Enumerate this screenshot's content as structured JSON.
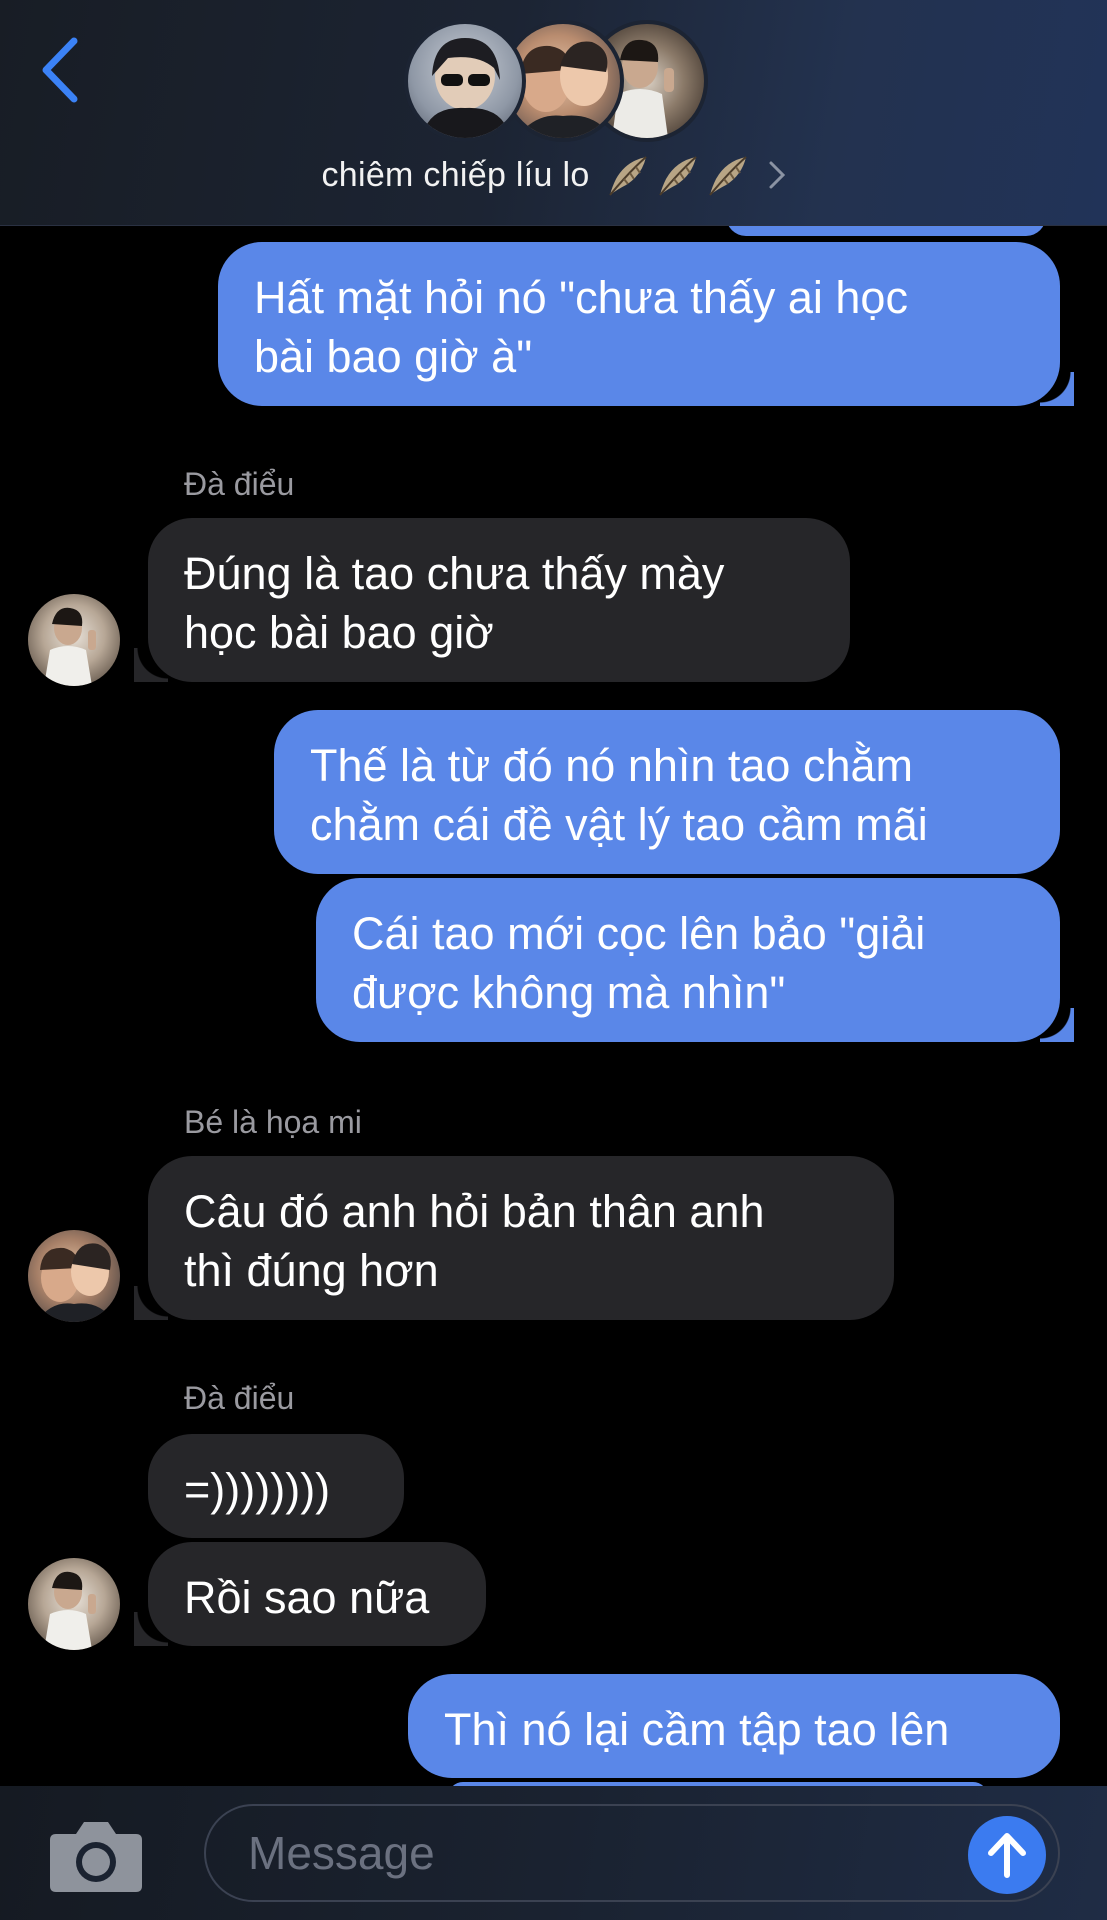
{
  "header": {
    "title": "chiêm chiếp líu lo",
    "title_emoji_count": 3,
    "emoji_icon": "feather-icon",
    "accent": "#3b82f6"
  },
  "thread": {
    "partial_top_bubble": "",
    "messages": [
      {
        "side": "out",
        "text": "Hất mặt hỏi nó \"chưa thấy ai học\nbài bao giờ à\""
      },
      {
        "sender": "Đà điểu"
      },
      {
        "side": "in",
        "text": "Đúng là tao chưa thấy mày\nhọc bài bao giờ"
      },
      {
        "side": "out",
        "text": "Thế là từ đó nó nhìn tao chằm\nchằm cái đề vật lý tao cầm mãi"
      },
      {
        "side": "out",
        "text": "Cái tao mới cọc lên bảo \"giải\nđược không mà nhìn\""
      },
      {
        "sender": "Bé là họa mi"
      },
      {
        "side": "in",
        "text": "Câu đó anh hỏi bản thân anh\nthì đúng hơn"
      },
      {
        "sender": "Đà điểu"
      },
      {
        "side": "in",
        "text": "=))))))))"
      },
      {
        "side": "in",
        "text": "Rồi sao nữa"
      },
      {
        "side": "out",
        "text": "Thì nó lại cầm tập tao lên"
      }
    ]
  },
  "input": {
    "placeholder": "Message"
  },
  "colors": {
    "outgoing_bubble": "#5a87e8",
    "incoming_bubble": "#262629",
    "send_button": "#3b7bf0"
  }
}
